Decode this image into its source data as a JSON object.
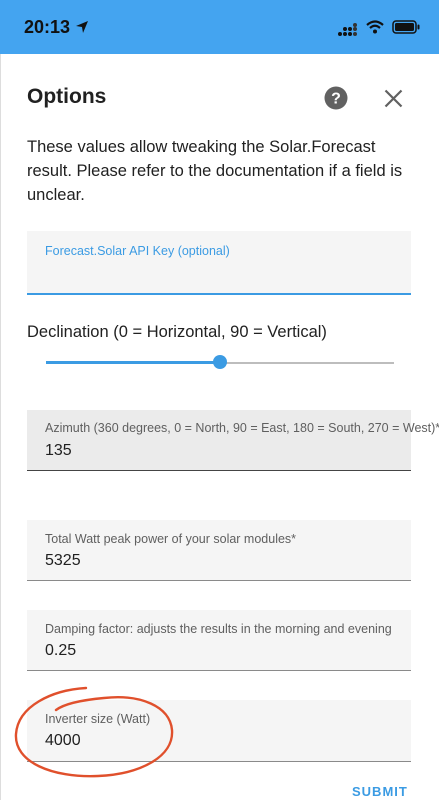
{
  "status_bar": {
    "time": "20:13",
    "background_color": "#44a4f0",
    "icons": [
      "location-arrow-icon",
      "signal-icon",
      "wifi-icon",
      "battery-icon"
    ]
  },
  "dialog": {
    "title": "Options",
    "help_icon": "question-circle-icon",
    "close_icon": "close-icon",
    "intro": "These values allow tweaking the Solar.Forecast result. Please refer to the documentation if a field is unclear."
  },
  "fields": {
    "api_key": {
      "label": "Forecast.Solar API Key (optional)",
      "value": ""
    },
    "declination": {
      "label": "Declination (0 = Horizontal, 90 = Vertical)",
      "value": 45,
      "min": 0,
      "max": 90
    },
    "azimuth": {
      "label": "Azimuth (360 degrees, 0 = North, 90 = East, 180 = South, 270 = West)*",
      "value": "135"
    },
    "watt_peak": {
      "label": "Total Watt peak power of your solar modules*",
      "value": "5325"
    },
    "damping": {
      "label": "Damping factor: adjusts the results in the morning and evening",
      "value": "0.25"
    },
    "inverter": {
      "label": "Inverter size (Watt)",
      "value": "4000"
    }
  },
  "actions": {
    "submit_label": "SUBMIT"
  },
  "colors": {
    "accent": "#3b9be3",
    "annotation": "#e0502c"
  }
}
